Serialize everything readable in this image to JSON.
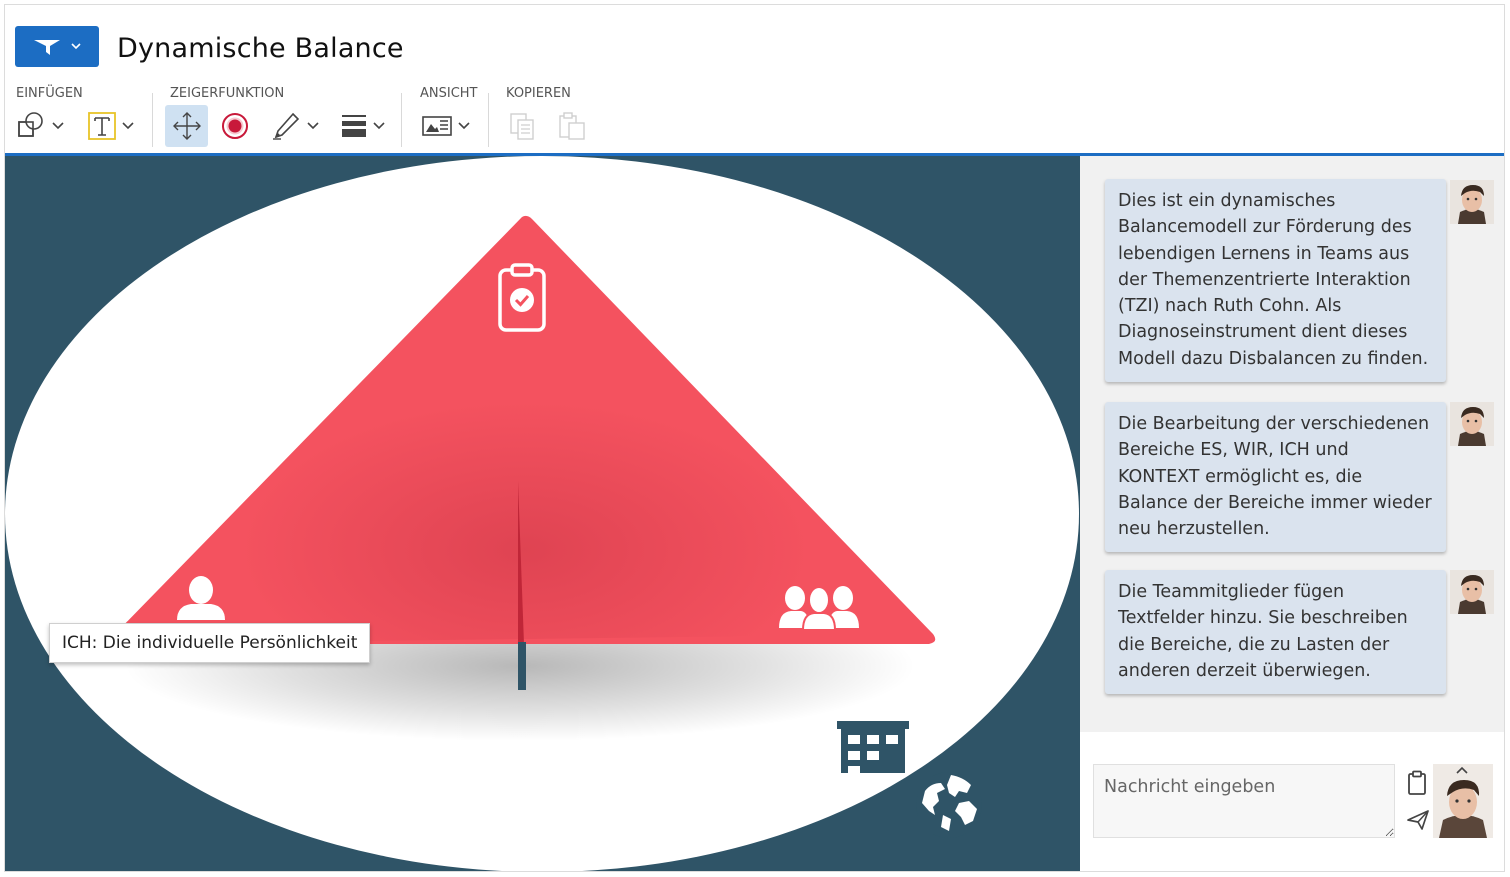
{
  "header": {
    "title": "Dynamische Balance",
    "menu_icon": "funnel-logo-icon"
  },
  "toolbar": {
    "groups": [
      {
        "label": "EINFÜGEN"
      },
      {
        "label": "ZEIGERFUNKTION"
      },
      {
        "label": "ANSICHT"
      },
      {
        "label": "KOPIEREN"
      }
    ],
    "tools": [
      "shapes-icon",
      "text-icon",
      "move-icon",
      "target-icon",
      "pen-icon",
      "line-weight-icon",
      "view-icon",
      "copy-icon",
      "paste-icon"
    ],
    "active_tool": "move-icon"
  },
  "canvas": {
    "tooltip": "ICH: Die individuelle Persönlichkeit",
    "icons": [
      "clipboard-check-icon",
      "person-icon",
      "group-icon",
      "building-icon",
      "globe-icon"
    ]
  },
  "chat": {
    "messages": [
      {
        "text": "Dies ist ein dynamisches Balancemodell zur Förderung des lebendigen Lernens in Teams aus der Themenzentrierte Interaktion (TZI) nach Ruth Cohn. Als Diagnoseinstrument dient dieses Modell dazu Disbalancen zu finden."
      },
      {
        "text": "Die Bearbeitung der verschiedenen Bereiche ES, WIR, ICH und KONTEXT ermöglicht es, die Balance der Bereiche immer wieder neu herzustellen."
      },
      {
        "text": "Die Teammitglieder fügen Textfelder hinzu. Sie beschreiben die Bereiche, die zu Lasten der anderen derzeit überwiegen."
      }
    ],
    "input_placeholder": "Nachricht eingeben"
  },
  "colors": {
    "accent": "#1c6dc3",
    "canvas_bg": "#2f5467",
    "triangle": "#f4525f",
    "message_bg": "#dae3ee"
  }
}
